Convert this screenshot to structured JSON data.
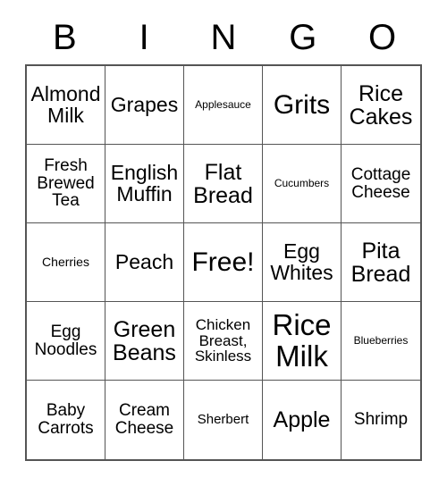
{
  "card": {
    "title_letters": [
      "B",
      "I",
      "N",
      "G",
      "O"
    ],
    "rows": [
      [
        {
          "label": "Almond\nMilk",
          "size": "fs-l2"
        },
        {
          "label": "Grapes",
          "size": "fs-l2"
        },
        {
          "label": "Applesauce",
          "size": "fs-xs"
        },
        {
          "label": "Grits",
          "size": "fs-xxl"
        },
        {
          "label": "Rice\nCakes",
          "size": "fs-xl"
        }
      ],
      [
        {
          "label": "Fresh\nBrewed\nTea",
          "size": "fs-m2"
        },
        {
          "label": "English\nMuffin",
          "size": "fs-l2"
        },
        {
          "label": "Flat\nBread",
          "size": "fs-xl"
        },
        {
          "label": "Cucumbers",
          "size": "fs-xs"
        },
        {
          "label": "Cottage\nCheese",
          "size": "fs-m2"
        }
      ],
      [
        {
          "label": "Cherries",
          "size": "fs-s"
        },
        {
          "label": "Peach",
          "size": "fs-l2"
        },
        {
          "label": "Free!",
          "size": "fs-xxl"
        },
        {
          "label": "Egg\nWhites",
          "size": "fs-l2"
        },
        {
          "label": "Pita\nBread",
          "size": "fs-xl"
        }
      ],
      [
        {
          "label": "Egg\nNoodles",
          "size": "fs-m2"
        },
        {
          "label": "Green\nBeans",
          "size": "fs-xl"
        },
        {
          "label": "Chicken\nBreast,\nSkinless",
          "size": "fs-m"
        },
        {
          "label": "Rice\nMilk",
          "size": "fs-xxxl"
        },
        {
          "label": "Blueberries",
          "size": "fs-xs"
        }
      ],
      [
        {
          "label": "Baby\nCarrots",
          "size": "fs-m2"
        },
        {
          "label": "Cream\nCheese",
          "size": "fs-m2"
        },
        {
          "label": "Sherbert",
          "size": "fs-s2"
        },
        {
          "label": "Apple",
          "size": "fs-xl"
        },
        {
          "label": "Shrimp",
          "size": "fs-m2"
        }
      ]
    ],
    "colors": {
      "border": "#555555",
      "background": "#ffffff",
      "text": "#000000"
    }
  }
}
